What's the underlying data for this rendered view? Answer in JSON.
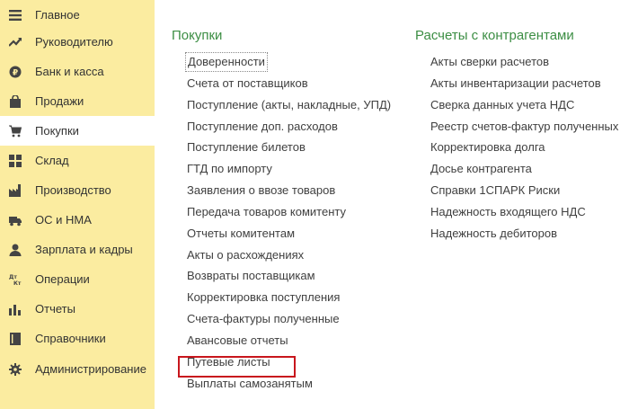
{
  "sidebar": {
    "items": [
      {
        "label": "Главное",
        "icon": "menu-icon"
      },
      {
        "label": "Руководителю",
        "icon": "trend-icon"
      },
      {
        "label": "Банк и касса",
        "icon": "coin-icon"
      },
      {
        "label": "Продажи",
        "icon": "shopping-bag-icon"
      },
      {
        "label": "Покупки",
        "icon": "shopping-cart-icon"
      },
      {
        "label": "Склад",
        "icon": "warehouse-grid-icon"
      },
      {
        "label": "Производство",
        "icon": "factory-icon"
      },
      {
        "label": "ОС и НМА",
        "icon": "truck-icon"
      },
      {
        "label": "Зарплата и кадры",
        "icon": "person-icon"
      },
      {
        "label": "Операции",
        "icon": "dt-kt-icon"
      },
      {
        "label": "Отчеты",
        "icon": "bar-chart-icon"
      },
      {
        "label": "Справочники",
        "icon": "book-icon"
      },
      {
        "label": "Администрирование",
        "icon": "gear-icon"
      }
    ],
    "active": "Покупки",
    "background": "#fbeca0"
  },
  "dt_kt_glyph": {
    "top": "Дт",
    "bottom": "Кт"
  },
  "purchases": {
    "title": "Покупки",
    "links": [
      "Доверенности",
      "Счета от поставщиков",
      "Поступление (акты, накладные, УПД)",
      "Поступление доп. расходов",
      "Поступление билетов",
      "ГТД по импорту",
      "Заявления о ввозе товаров",
      "Передача товаров комитенту",
      "Отчеты комитентам",
      "Акты о расхождениях",
      "Возвраты поставщикам",
      "Корректировка поступления",
      "Счета-фактуры полученные",
      "Авансовые отчеты",
      "Путевые листы",
      "Выплаты самозанятым"
    ]
  },
  "settlements": {
    "title": "Расчеты с контрагентами",
    "links": [
      "Акты сверки расчетов",
      "Акты инвентаризации расчетов",
      "Сверка данных учета НДС",
      "Реестр счетов-фактур полученных",
      "Корректировка долга",
      "Досье контрагента",
      "Справки 1СПАРК Риски",
      "Надежность входящего НДС",
      "Надежность дебиторов"
    ]
  },
  "colors": {
    "section_title": "#3c8e44",
    "link_text": "#404040",
    "highlight": "#c8161d"
  }
}
